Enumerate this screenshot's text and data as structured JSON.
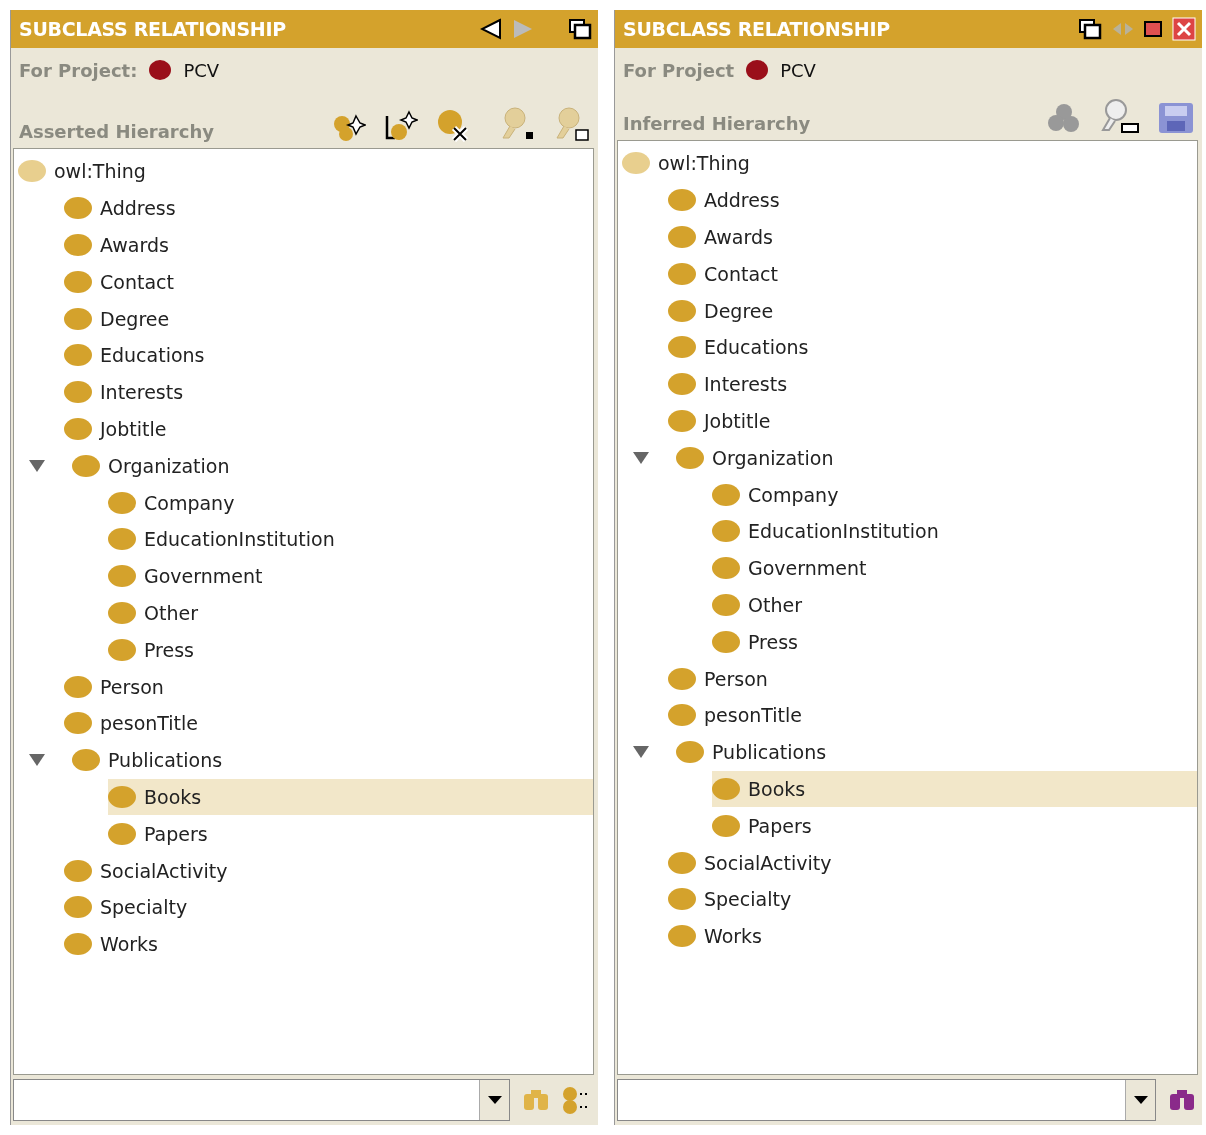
{
  "panels": [
    {
      "title": "SUBCLASS RELATIONSHIP",
      "project_label": "For Project:",
      "project": "PCV",
      "hierarchy_label": "Asserted Hierarchy",
      "tree": [
        {
          "label": "owl:Thing",
          "selected": false,
          "children": [
            {
              "label": "Address",
              "selected": false
            },
            {
              "label": "Awards",
              "selected": false
            },
            {
              "label": "Contact",
              "selected": false
            },
            {
              "label": "Degree",
              "selected": false
            },
            {
              "label": "Educations",
              "selected": false
            },
            {
              "label": "Interests",
              "selected": false
            },
            {
              "label": "Jobtitle",
              "selected": false
            },
            {
              "label": "Organization",
              "selected": false,
              "expanded": true,
              "children": [
                {
                  "label": "Company",
                  "selected": false
                },
                {
                  "label": "EducationInstitution",
                  "selected": false
                },
                {
                  "label": "Government",
                  "selected": false
                },
                {
                  "label": "Other",
                  "selected": false
                },
                {
                  "label": "Press",
                  "selected": false
                }
              ]
            },
            {
              "label": "Person",
              "selected": false
            },
            {
              "label": "pesonTitle",
              "selected": false
            },
            {
              "label": "Publications",
              "selected": false,
              "expanded": true,
              "children": [
                {
                  "label": "Books",
                  "selected": true
                },
                {
                  "label": "Papers",
                  "selected": false
                }
              ]
            },
            {
              "label": "SocialActivity",
              "selected": false
            },
            {
              "label": "Specialty",
              "selected": false
            },
            {
              "label": "Works",
              "selected": false
            }
          ]
        }
      ]
    },
    {
      "title": "SUBCLASS RELATIONSHIP",
      "project_label": "For Project",
      "project": "PCV",
      "hierarchy_label": "Inferred Hierarchy",
      "tree": [
        {
          "label": "owl:Thing",
          "selected": false,
          "children": [
            {
              "label": "Address",
              "selected": false
            },
            {
              "label": "Awards",
              "selected": false
            },
            {
              "label": "Contact",
              "selected": false
            },
            {
              "label": "Degree",
              "selected": false
            },
            {
              "label": "Educations",
              "selected": false
            },
            {
              "label": "Interests",
              "selected": false
            },
            {
              "label": "Jobtitle",
              "selected": false
            },
            {
              "label": "Organization",
              "selected": false,
              "expanded": true,
              "children": [
                {
                  "label": "Company",
                  "selected": false
                },
                {
                  "label": "EducationInstitution",
                  "selected": false
                },
                {
                  "label": "Government",
                  "selected": false
                },
                {
                  "label": "Other",
                  "selected": false
                },
                {
                  "label": "Press",
                  "selected": false
                }
              ]
            },
            {
              "label": "Person",
              "selected": false
            },
            {
              "label": "pesonTitle",
              "selected": false
            },
            {
              "label": "Publications",
              "selected": false,
              "expanded": true,
              "children": [
                {
                  "label": "Books",
                  "selected": true
                },
                {
                  "label": "Papers",
                  "selected": false
                }
              ]
            },
            {
              "label": "SocialActivity",
              "selected": false
            },
            {
              "label": "Specialty",
              "selected": false
            },
            {
              "label": "Works",
              "selected": false
            }
          ]
        }
      ]
    }
  ]
}
